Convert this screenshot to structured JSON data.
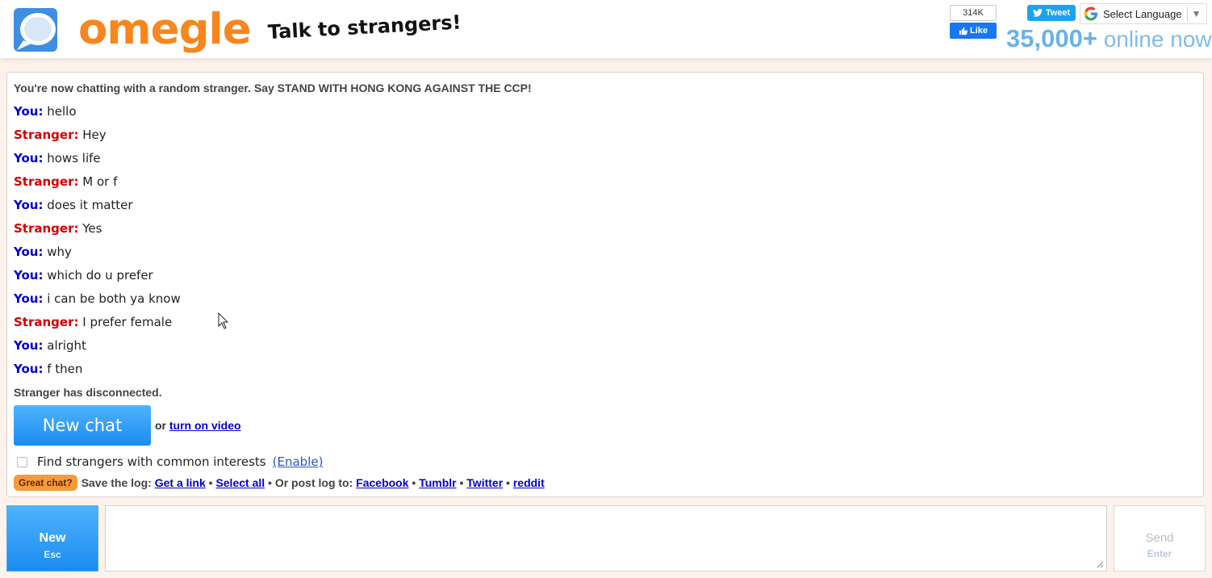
{
  "header": {
    "logo_text": "omegle",
    "tagline": "Talk to strangers!",
    "fb_count": "314K",
    "fb_like": "Like",
    "tweet": "Tweet",
    "language": "Select Language",
    "online_count": "35,000+",
    "online_label": "online now"
  },
  "chat": {
    "intro": "You're now chatting with a random stranger. Say STAND WITH HONG KONG AGAINST THE CCP!",
    "you_label": "You:",
    "stranger_label": "Stranger:",
    "messages": [
      {
        "who": "You:",
        "text": "hello"
      },
      {
        "who": "Stranger:",
        "text": "Hey"
      },
      {
        "who": "You:",
        "text": "hows life"
      },
      {
        "who": "Stranger:",
        "text": "M or f"
      },
      {
        "who": "You:",
        "text": "does it matter"
      },
      {
        "who": "Stranger:",
        "text": "Yes"
      },
      {
        "who": "You:",
        "text": "why"
      },
      {
        "who": "You:",
        "text": "which do u prefer"
      },
      {
        "who": "You:",
        "text": "i can be both ya know"
      },
      {
        "who": "Stranger:",
        "text": "I prefer female"
      },
      {
        "who": "You:",
        "text": "alright"
      },
      {
        "who": "You:",
        "text": "f then"
      }
    ],
    "disconnected": "Stranger has disconnected.",
    "new_chat_label": "New chat",
    "or_text": "or",
    "video_link": "turn on video",
    "interests_label": "Find strangers with common interests",
    "enable_link": "(Enable)",
    "great_chat": "Great chat?",
    "save_log_text": "Save the log:",
    "get_link": "Get a link",
    "select_all": "Select all",
    "post_log_text": "Or post log to:",
    "facebook": "Facebook",
    "tumblr": "Tumblr",
    "twitter": "Twitter",
    "reddit": "reddit",
    "bullet": "•"
  },
  "bottom": {
    "new_label": "New",
    "new_key": "Esc",
    "send_label": "Send",
    "send_key": "Enter",
    "message_value": ""
  },
  "colors": {
    "orange": "#f7861e",
    "you": "#0000cc",
    "stranger": "#d40000",
    "button_blue": "#1b8cf0"
  }
}
